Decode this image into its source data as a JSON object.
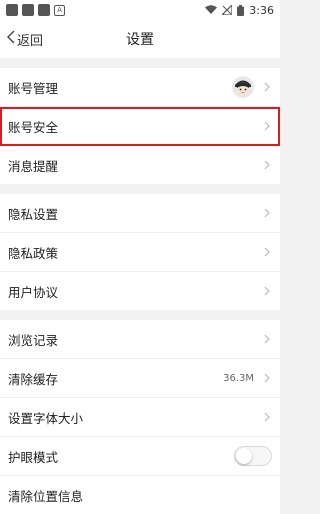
{
  "status": {
    "time": "3:36"
  },
  "nav": {
    "back_label": "返回",
    "title": "设置"
  },
  "groups": {
    "account": [
      {
        "label": "账号管理"
      },
      {
        "label": "账号安全"
      },
      {
        "label": "消息提醒"
      }
    ],
    "privacy": [
      {
        "label": "隐私设置"
      },
      {
        "label": "隐私政策"
      },
      {
        "label": "用户协议"
      }
    ],
    "misc": [
      {
        "label": "浏览记录"
      },
      {
        "label": "清除缓存",
        "value": "36.3M"
      },
      {
        "label": "设置字体大小"
      },
      {
        "label": "护眼模式",
        "toggle": false
      },
      {
        "label": "清除位置信息"
      }
    ]
  },
  "colors": {
    "highlight": "#d61e24",
    "background": "#f2f2f2"
  }
}
